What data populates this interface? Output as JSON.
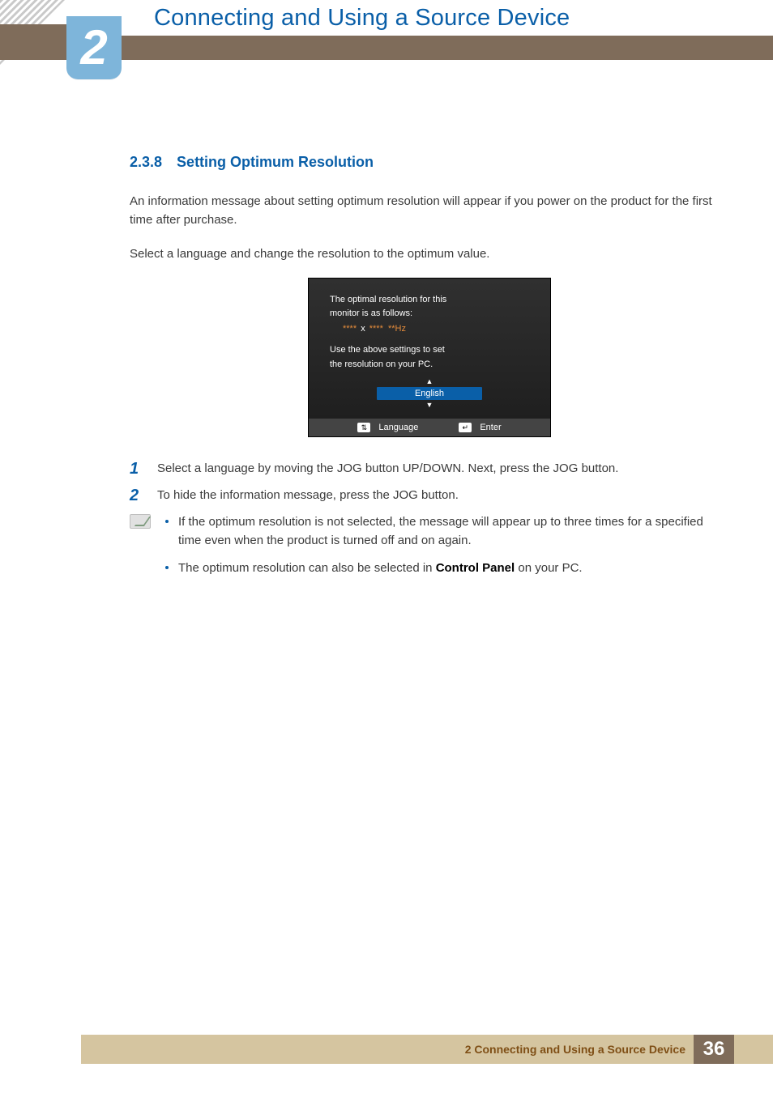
{
  "header": {
    "chapter_number": "2",
    "chapter_title": "Connecting and Using a Source Device"
  },
  "section": {
    "number": "2.3.8",
    "title": "Setting Optimum Resolution"
  },
  "intro": {
    "p1": "An information message about setting optimum resolution will appear if you power on the product for the first time after purchase.",
    "p2": "Select a language and change the resolution to the optimum value."
  },
  "osd": {
    "line1": "The optimal resolution for this",
    "line2": "monitor is as follows:",
    "res_left": "****",
    "res_x": "x",
    "res_right": "****",
    "res_hz": "**Hz",
    "line3": "Use the above settings to set",
    "line4": "the resolution on your PC.",
    "language_value": "English",
    "footer_language_label": "Language",
    "footer_enter_label": "Enter",
    "footer_updown_glyph": "⇅",
    "footer_enter_glyph": "↵"
  },
  "steps": [
    {
      "n": "1",
      "text": "Select a language by moving the JOG button UP/DOWN. Next, press the JOG button."
    },
    {
      "n": "2",
      "text": "To hide the information message, press the JOG button."
    }
  ],
  "notes": {
    "item1": "If the optimum resolution is not selected, the message will appear up to three times for a specified time even when the product is turned off and on again.",
    "item2_pre": "The optimum resolution can also be selected in ",
    "item2_bold": "Control Panel",
    "item2_post": " on your PC."
  },
  "footer": {
    "label": "2 Connecting and Using a Source Device",
    "page": "36"
  }
}
